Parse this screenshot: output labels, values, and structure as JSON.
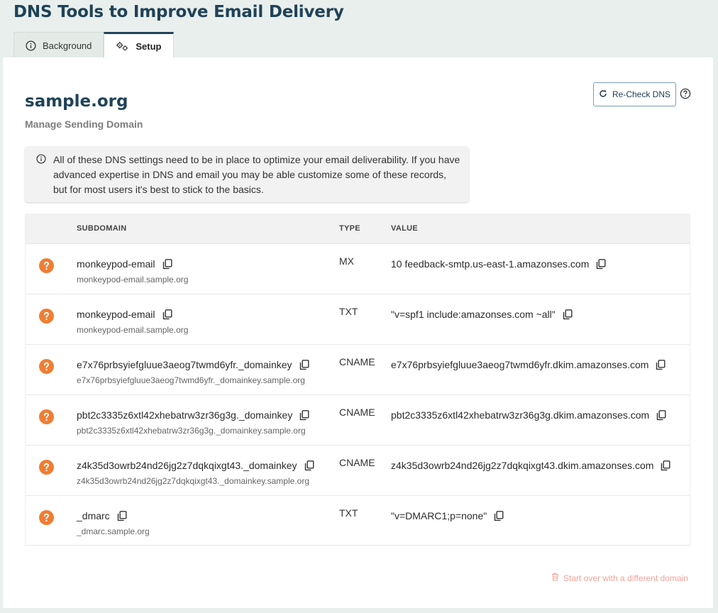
{
  "page": {
    "title": "DNS Tools to Improve Email Delivery"
  },
  "tabs": [
    {
      "label": "Background",
      "icon": "info-icon",
      "active": false
    },
    {
      "label": "Setup",
      "icon": "gears-icon",
      "active": true
    }
  ],
  "domain": {
    "name": "sample.org",
    "subtitle": "Manage Sending Domain"
  },
  "recheck": {
    "label": "Re-Check DNS"
  },
  "notice": {
    "text": "All of these DNS settings need to be in place to optimize your email deliverability. If you have advanced expertise in DNS and email you may be able customize some of these records, but for most users it's best to stick to the basics."
  },
  "table": {
    "headers": {
      "subdomain": "SUBDOMAIN",
      "type": "TYPE",
      "value": "VALUE"
    },
    "rows": [
      {
        "subdomain": "monkeypod-email",
        "full": "monkeypod-email.sample.org",
        "type": "MX",
        "value": "10 feedback-smtp.us-east-1.amazonses.com",
        "status": "unknown"
      },
      {
        "subdomain": "monkeypod-email",
        "full": "monkeypod-email.sample.org",
        "type": "TXT",
        "value": "\"v=spf1 include:amazonses.com ~all\"",
        "status": "unknown"
      },
      {
        "subdomain": "e7x76prbsyiefgluue3aeog7twmd6yfr._domainkey",
        "full": "e7x76prbsyiefgluue3aeog7twmd6yfr._domainkey.sample.org",
        "type": "CNAME",
        "value": "e7x76prbsyiefgluue3aeog7twmd6yfr.dkim.amazonses.com",
        "status": "unknown"
      },
      {
        "subdomain": "pbt2c3335z6xtl42xhebatrw3zr36g3g._domainkey",
        "full": "pbt2c3335z6xtl42xhebatrw3zr36g3g._domainkey.sample.org",
        "type": "CNAME",
        "value": "pbt2c3335z6xtl42xhebatrw3zr36g3g.dkim.amazonses.com",
        "status": "unknown"
      },
      {
        "subdomain": "z4k35d3owrb24nd26jg2z7dqkqixgt43._domainkey",
        "full": "z4k35d3owrb24nd26jg2z7dqkqixgt43._domainkey.sample.org",
        "type": "CNAME",
        "value": "z4k35d3owrb24nd26jg2z7dqkqixgt43.dkim.amazonses.com",
        "status": "unknown"
      },
      {
        "subdomain": "_dmarc",
        "full": "_dmarc.sample.org",
        "type": "TXT",
        "value": "\"v=DMARC1;p=none\"",
        "status": "unknown"
      }
    ]
  },
  "footer": {
    "startover_label": "Start over with a different domain"
  },
  "colors": {
    "brand": "#1f4258",
    "status_unknown": "#f07d32",
    "danger_light": "#f0a39a"
  }
}
